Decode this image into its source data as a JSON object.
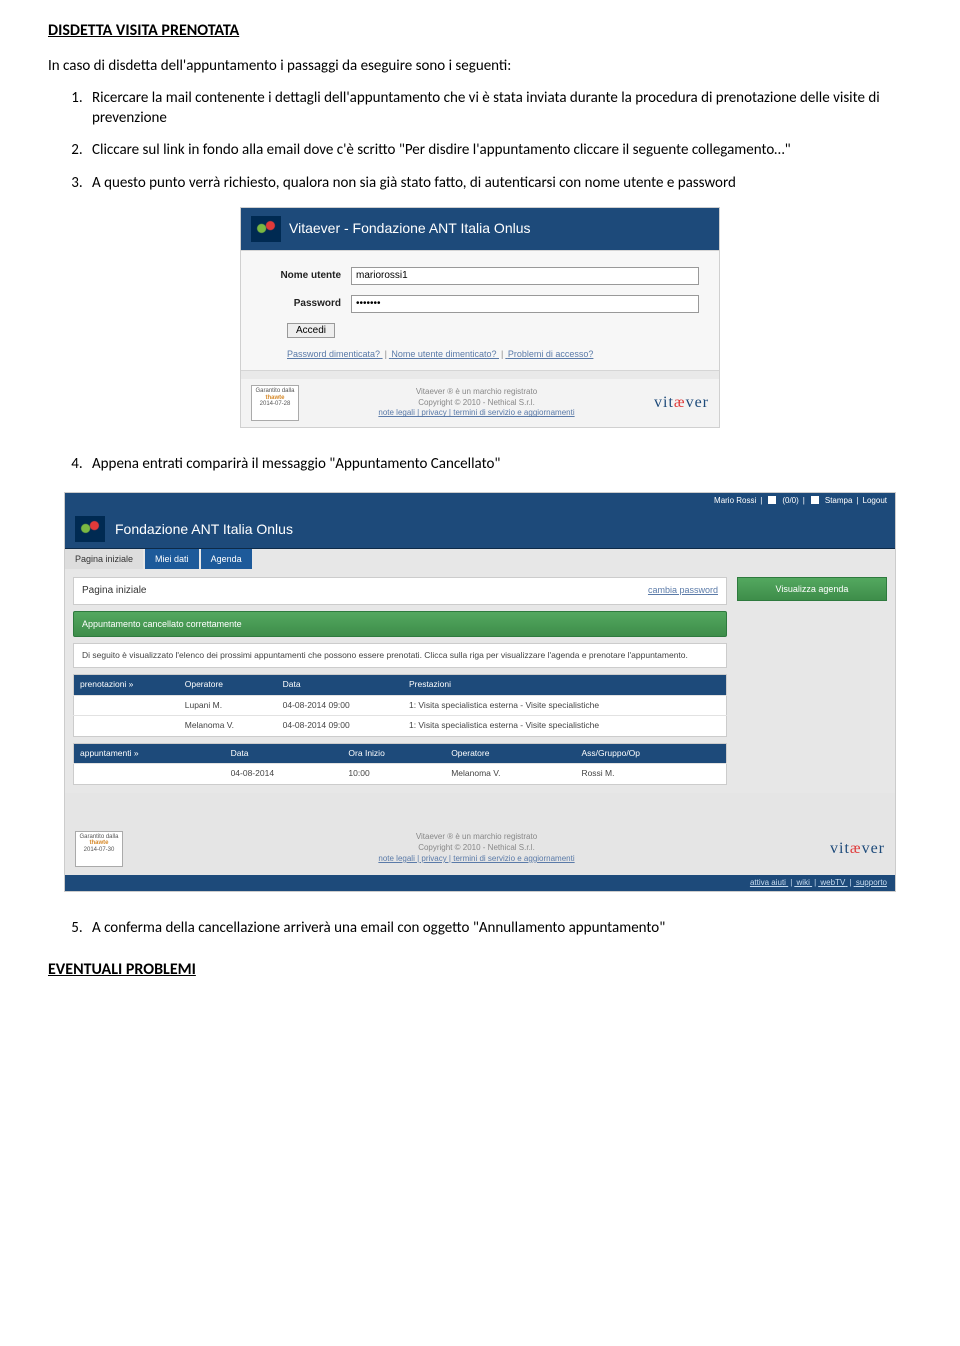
{
  "title": "DISDETTA VISITA PRENOTATA",
  "intro": "In caso di disdetta dell'appuntamento i passaggi da eseguire sono i seguenti:",
  "steps": {
    "s1": "Ricercare la mail contenente i dettagli dell'appuntamento che vi è stata inviata durante la procedura di prenotazione delle visite di prevenzione",
    "s2": "Cliccare sul link in fondo alla email dove c'è scritto \"Per disdire l'appuntamento cliccare il seguente collegamento…\"",
    "s3": "A questo punto verrà richiesto, qualora non sia già stato fatto, di autenticarsi con nome utente e password",
    "s4": "Appena entrati comparirà il messaggio \"Appuntamento Cancellato\"",
    "s5": "A conferma della cancellazione arriverà una email con oggetto \"Annullamento appuntamento\""
  },
  "footer_heading": "EVENTUALI PROBLEMI",
  "login": {
    "header_title": "Vitaever - Fondazione ANT Italia Onlus",
    "username_label": "Nome utente",
    "username_value": "mariorossi1",
    "password_label": "Password",
    "password_value": "•••••••",
    "submit": "Accedi",
    "link_forgot_pw": "Password dimenticata?",
    "link_forgot_user": "Nome utente dimenticato?",
    "link_access_problems": "Problemi di accesso?",
    "footer_reg": "Vitaever ® è un marchio registrato",
    "footer_copy": "Copyright © 2010 - Nethical S.r.l.",
    "footer_links": "note legali | privacy | termini di servizio e aggiornamenti",
    "thawte_line1": "Garantito dalla",
    "thawte_brand": "thawte",
    "thawte_date": "2014-07-28",
    "vitaever_brand_pre": "vit",
    "vitaever_brand_mid": "æ",
    "vitaever_brand_post": "ver"
  },
  "dash": {
    "user": "Mario Rossi",
    "mailcount": "(0/0)",
    "print": "Stampa",
    "logout": "Logout",
    "header_title": "Fondazione ANT Italia Onlus",
    "tabs": {
      "t1": "Pagina iniziale",
      "t2": "Miei dati",
      "t3": "Agenda"
    },
    "page_title": "Pagina iniziale",
    "cambia_pw": "cambia password",
    "visualizza_agenda": "Visualizza agenda",
    "alert": "Appuntamento cancellato correttamente",
    "desc": "Di seguito è visualizzato l'elenco dei prossimi appuntamenti che possono essere prenotati. Clicca sulla riga per visualizzare l'agenda e prenotare l'appuntamento.",
    "tableA": {
      "h0": "prenotazioni »",
      "h1": "Operatore",
      "h2": "Data",
      "h3": "Prestazioni",
      "rows": [
        {
          "op": "Lupani M.",
          "date": "04-08-2014 09:00",
          "pres": "1: Visita specialistica esterna - Visite specialistiche"
        },
        {
          "op": "Melanoma V.",
          "date": "04-08-2014 09:00",
          "pres": "1: Visita specialistica esterna - Visite specialistiche"
        }
      ]
    },
    "tableB": {
      "h0": "appuntamenti »",
      "h1": "Data",
      "h2": "Ora Inizio",
      "h3": "Operatore",
      "h4": "Ass/Gruppo/Op",
      "rows": [
        {
          "date": "04-08-2014",
          "ora": "10:00",
          "op": "Melanoma V.",
          "ass": "Rossi M."
        }
      ]
    },
    "footer_reg": "Vitaever ® è un marchio registrato",
    "footer_copy": "Copyright © 2010 - Nethical S.r.l.",
    "footer_links": "note legali | privacy | termini di servizio e aggiornamenti",
    "thawte_date": "2014-07-30",
    "bottom": {
      "l1": "attiva aiuti",
      "l2": "wiki",
      "l3": "webTV",
      "l4": "supporto"
    }
  }
}
